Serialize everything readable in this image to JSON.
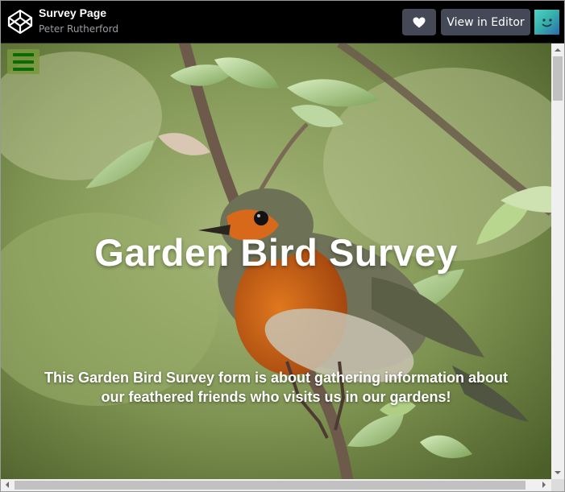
{
  "header": {
    "title": "Survey Page",
    "author": "Peter Rutherford",
    "editor_button": "View in Editor",
    "icons": {
      "logo": "codepen-logo-icon",
      "heart": "heart-icon",
      "avatar": "avatar"
    }
  },
  "main": {
    "menu_icon": "hamburger-menu-icon",
    "heading": "Garden Bird Survey",
    "description": "This Garden Bird Survey form is about gathering information about our feathered friends who visits us in our gardens!"
  },
  "colors": {
    "topbar_bg": "#000000",
    "button_bg": "#444857",
    "menu_green": "#0b6a07"
  }
}
